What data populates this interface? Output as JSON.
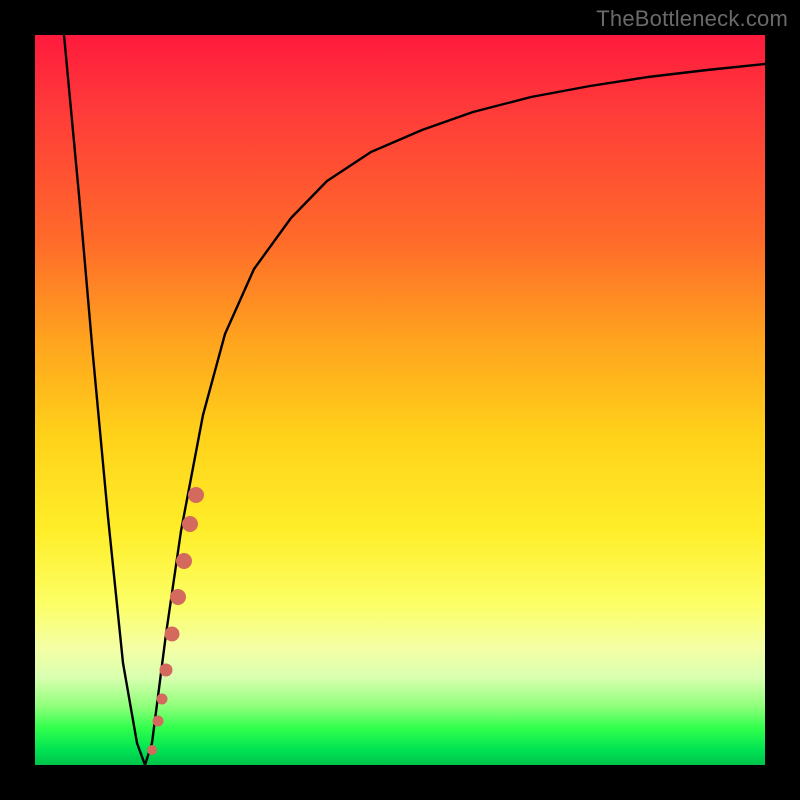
{
  "watermark": "TheBottleneck.com",
  "colors": {
    "curve": "#000000",
    "marker": "#d46a5e",
    "frame": "#000000"
  },
  "chart_data": {
    "type": "line",
    "title": "",
    "xlabel": "",
    "ylabel": "",
    "xlim": [
      0,
      100
    ],
    "ylim": [
      0,
      100
    ],
    "grid": false,
    "legend": false,
    "series": [
      {
        "name": "bottleneck-curve",
        "x": [
          4,
          6,
          8,
          10,
          12,
          14,
          15,
          16,
          18,
          20,
          23,
          26,
          30,
          35,
          40,
          46,
          53,
          60,
          68,
          76,
          84,
          92,
          100
        ],
        "y": [
          100,
          78,
          56,
          34,
          14,
          3,
          0,
          3,
          18,
          32,
          48,
          59,
          68,
          75,
          80,
          84,
          87,
          89.5,
          91.5,
          93,
          94.2,
          95.2,
          96
        ]
      }
    ],
    "markers": [
      {
        "name": "highlight-cluster",
        "shape": "circle",
        "color": "#d46a5e",
        "points": [
          {
            "x": 16.0,
            "y": 2
          },
          {
            "x": 16.8,
            "y": 6
          },
          {
            "x": 17.4,
            "y": 9
          },
          {
            "x": 18.0,
            "y": 13
          },
          {
            "x": 18.8,
            "y": 18
          },
          {
            "x": 19.6,
            "y": 23
          },
          {
            "x": 20.4,
            "y": 28
          },
          {
            "x": 21.2,
            "y": 33
          },
          {
            "x": 22.0,
            "y": 37
          }
        ]
      }
    ]
  }
}
